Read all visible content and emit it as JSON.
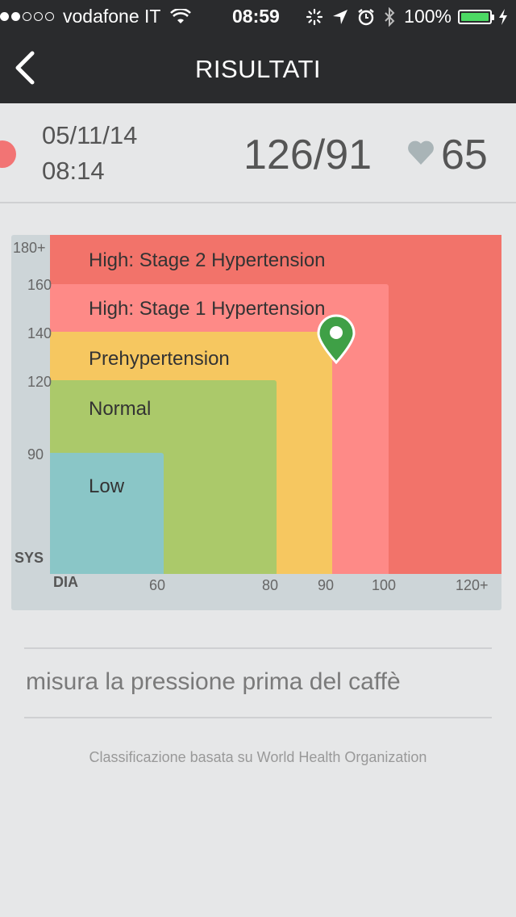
{
  "status_bar": {
    "carrier": "vodafone IT",
    "time": "08:59",
    "battery": "100%",
    "icons": [
      "signal-dots-icon",
      "wifi-icon",
      "activity-icon",
      "location-icon",
      "alarm-icon",
      "bluetooth-icon",
      "battery-icon",
      "charging-icon"
    ]
  },
  "nav": {
    "title": "RISULTATI",
    "back_icon": "chevron-left-icon"
  },
  "reading": {
    "date": "05/11/14",
    "time": "08:14",
    "pressure": "126/91",
    "pulse": "65",
    "status_color": "#f27474",
    "heart_icon": "heart-icon"
  },
  "chart": {
    "zones": [
      {
        "label": "High: Stage 2 Hypertension",
        "color": "#f2736a"
      },
      {
        "label": "High: Stage 1 Hypertension",
        "color": "#fe8a87"
      },
      {
        "label": "Prehypertension",
        "color": "#f6c760"
      },
      {
        "label": "Normal",
        "color": "#abc96a"
      },
      {
        "label": "Low",
        "color": "#8ac6c7"
      }
    ],
    "y_axis": {
      "name": "SYS",
      "ticks": [
        "180+",
        "160",
        "140",
        "120",
        "90"
      ]
    },
    "x_axis": {
      "name": "DIA",
      "ticks": [
        "60",
        "80",
        "90",
        "100",
        "120+"
      ]
    },
    "marker_icon": "map-pin-icon",
    "marker_color": "#3fa046"
  },
  "note": "misura la pressione prima del caffè",
  "footer": "Classificazione basata su World Health Organization"
}
